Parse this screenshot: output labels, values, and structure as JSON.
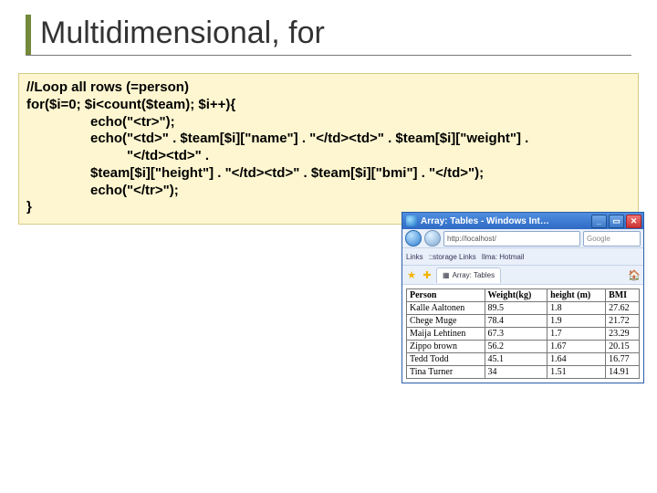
{
  "slide": {
    "title": "Multidimensional, for"
  },
  "code": {
    "l1": "//Loop all rows (=person)",
    "l2": "for($i=0; $i<count($team); $i++){",
    "l3": "echo(\"<tr>\");",
    "l4": "echo(\"<td>\" . $team[$i][\"name\"] . \"</td><td>\" . $team[$i][\"weight\"] .",
    "l5": "\"</td><td>\" .",
    "l6": " $team[$i][\"height\"] . \"</td><td>\" . $team[$i][\"bmi\"] . \"</td>\");",
    "l7": "echo(\"</tr>\");",
    "l8": "}"
  },
  "browser": {
    "title": "Array: Tables - Windows Int…",
    "url": "http://localhost/",
    "search": "Google",
    "links_label": "Links",
    "link_items": [
      "::storage Links",
      "Ilma: Hotmail"
    ],
    "tab_label": "Array: Tables",
    "table": {
      "headers": [
        "Person",
        "Weight(kg)",
        "height (m)",
        "BMI"
      ],
      "rows": [
        [
          "Kalle Aaltonen",
          "89.5",
          "1.8",
          "27.62"
        ],
        [
          "Chege Muge",
          "78.4",
          "1.9",
          "21.72"
        ],
        [
          "Maija Lehtinen",
          "67.3",
          "1.7",
          "23.29"
        ],
        [
          "Zippo brown",
          "56.2",
          "1.67",
          "20.15"
        ],
        [
          "Tedd Todd",
          "45.1",
          "1.64",
          "16.77"
        ],
        [
          "Tina Turner",
          "34",
          "1.51",
          "14.91"
        ]
      ]
    }
  }
}
